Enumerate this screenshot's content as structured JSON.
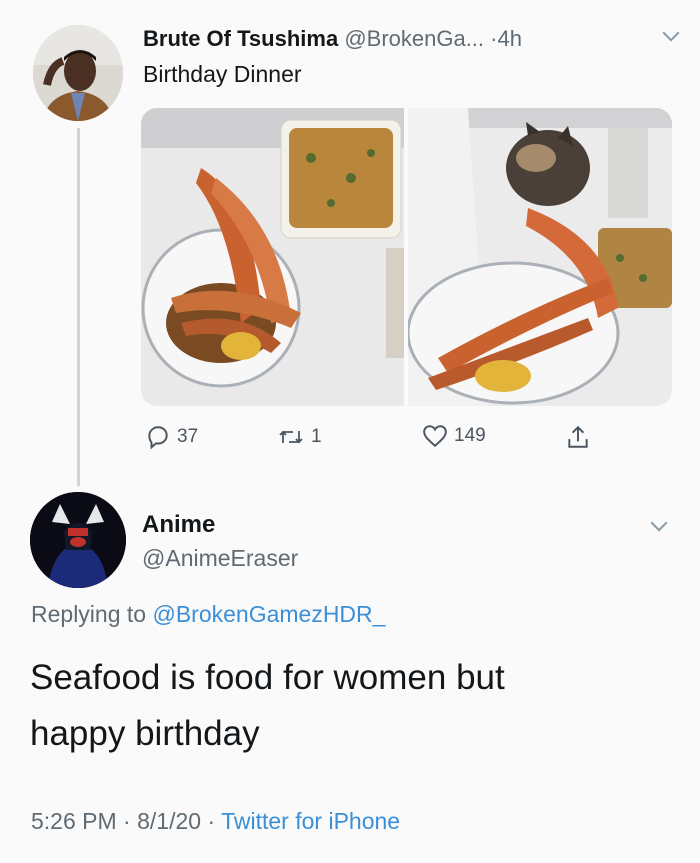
{
  "tweet1": {
    "display_name": "Brute Of Tsushima",
    "handle": "@BrokenGa...",
    "separator": "·",
    "time": "4h",
    "text": "Birthday Dinner",
    "stats": {
      "replies": "37",
      "retweets": "1",
      "likes": "149"
    }
  },
  "tweet2": {
    "display_name": "Anime",
    "handle": "@AnimeEraser",
    "replying_prefix": "Replying to",
    "replying_handle": "@BrokenGamezHDR_",
    "text_line1": "Seafood is food for women but",
    "text_line2": "happy birthday",
    "time": "5:26 PM",
    "sep1": "·",
    "date": "8/1/20",
    "sep2": "·",
    "source": "Twitter for iPhone"
  },
  "colors": {
    "link_blue": "#3a8fd6",
    "muted_gray": "#5f6a73",
    "thread_line": "#ccd6dd"
  },
  "icons": [
    "reply-icon",
    "retweet-icon",
    "like-icon",
    "share-icon",
    "chevron-down-icon"
  ]
}
